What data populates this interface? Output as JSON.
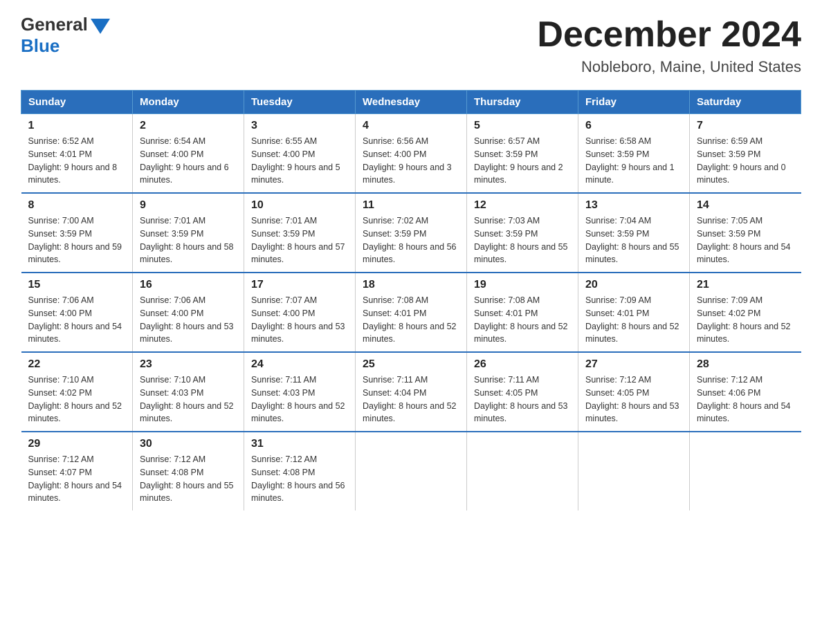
{
  "header": {
    "logo_general": "General",
    "logo_blue": "Blue",
    "title": "December 2024",
    "subtitle": "Nobleboro, Maine, United States"
  },
  "days_of_week": [
    "Sunday",
    "Monday",
    "Tuesday",
    "Wednesday",
    "Thursday",
    "Friday",
    "Saturday"
  ],
  "weeks": [
    [
      {
        "day": "1",
        "sunrise": "6:52 AM",
        "sunset": "4:01 PM",
        "daylight": "9 hours and 8 minutes."
      },
      {
        "day": "2",
        "sunrise": "6:54 AM",
        "sunset": "4:00 PM",
        "daylight": "9 hours and 6 minutes."
      },
      {
        "day": "3",
        "sunrise": "6:55 AM",
        "sunset": "4:00 PM",
        "daylight": "9 hours and 5 minutes."
      },
      {
        "day": "4",
        "sunrise": "6:56 AM",
        "sunset": "4:00 PM",
        "daylight": "9 hours and 3 minutes."
      },
      {
        "day": "5",
        "sunrise": "6:57 AM",
        "sunset": "3:59 PM",
        "daylight": "9 hours and 2 minutes."
      },
      {
        "day": "6",
        "sunrise": "6:58 AM",
        "sunset": "3:59 PM",
        "daylight": "9 hours and 1 minute."
      },
      {
        "day": "7",
        "sunrise": "6:59 AM",
        "sunset": "3:59 PM",
        "daylight": "9 hours and 0 minutes."
      }
    ],
    [
      {
        "day": "8",
        "sunrise": "7:00 AM",
        "sunset": "3:59 PM",
        "daylight": "8 hours and 59 minutes."
      },
      {
        "day": "9",
        "sunrise": "7:01 AM",
        "sunset": "3:59 PM",
        "daylight": "8 hours and 58 minutes."
      },
      {
        "day": "10",
        "sunrise": "7:01 AM",
        "sunset": "3:59 PM",
        "daylight": "8 hours and 57 minutes."
      },
      {
        "day": "11",
        "sunrise": "7:02 AM",
        "sunset": "3:59 PM",
        "daylight": "8 hours and 56 minutes."
      },
      {
        "day": "12",
        "sunrise": "7:03 AM",
        "sunset": "3:59 PM",
        "daylight": "8 hours and 55 minutes."
      },
      {
        "day": "13",
        "sunrise": "7:04 AM",
        "sunset": "3:59 PM",
        "daylight": "8 hours and 55 minutes."
      },
      {
        "day": "14",
        "sunrise": "7:05 AM",
        "sunset": "3:59 PM",
        "daylight": "8 hours and 54 minutes."
      }
    ],
    [
      {
        "day": "15",
        "sunrise": "7:06 AM",
        "sunset": "4:00 PM",
        "daylight": "8 hours and 54 minutes."
      },
      {
        "day": "16",
        "sunrise": "7:06 AM",
        "sunset": "4:00 PM",
        "daylight": "8 hours and 53 minutes."
      },
      {
        "day": "17",
        "sunrise": "7:07 AM",
        "sunset": "4:00 PM",
        "daylight": "8 hours and 53 minutes."
      },
      {
        "day": "18",
        "sunrise": "7:08 AM",
        "sunset": "4:01 PM",
        "daylight": "8 hours and 52 minutes."
      },
      {
        "day": "19",
        "sunrise": "7:08 AM",
        "sunset": "4:01 PM",
        "daylight": "8 hours and 52 minutes."
      },
      {
        "day": "20",
        "sunrise": "7:09 AM",
        "sunset": "4:01 PM",
        "daylight": "8 hours and 52 minutes."
      },
      {
        "day": "21",
        "sunrise": "7:09 AM",
        "sunset": "4:02 PM",
        "daylight": "8 hours and 52 minutes."
      }
    ],
    [
      {
        "day": "22",
        "sunrise": "7:10 AM",
        "sunset": "4:02 PM",
        "daylight": "8 hours and 52 minutes."
      },
      {
        "day": "23",
        "sunrise": "7:10 AM",
        "sunset": "4:03 PM",
        "daylight": "8 hours and 52 minutes."
      },
      {
        "day": "24",
        "sunrise": "7:11 AM",
        "sunset": "4:03 PM",
        "daylight": "8 hours and 52 minutes."
      },
      {
        "day": "25",
        "sunrise": "7:11 AM",
        "sunset": "4:04 PM",
        "daylight": "8 hours and 52 minutes."
      },
      {
        "day": "26",
        "sunrise": "7:11 AM",
        "sunset": "4:05 PM",
        "daylight": "8 hours and 53 minutes."
      },
      {
        "day": "27",
        "sunrise": "7:12 AM",
        "sunset": "4:05 PM",
        "daylight": "8 hours and 53 minutes."
      },
      {
        "day": "28",
        "sunrise": "7:12 AM",
        "sunset": "4:06 PM",
        "daylight": "8 hours and 54 minutes."
      }
    ],
    [
      {
        "day": "29",
        "sunrise": "7:12 AM",
        "sunset": "4:07 PM",
        "daylight": "8 hours and 54 minutes."
      },
      {
        "day": "30",
        "sunrise": "7:12 AM",
        "sunset": "4:08 PM",
        "daylight": "8 hours and 55 minutes."
      },
      {
        "day": "31",
        "sunrise": "7:12 AM",
        "sunset": "4:08 PM",
        "daylight": "8 hours and 56 minutes."
      },
      null,
      null,
      null,
      null
    ]
  ]
}
